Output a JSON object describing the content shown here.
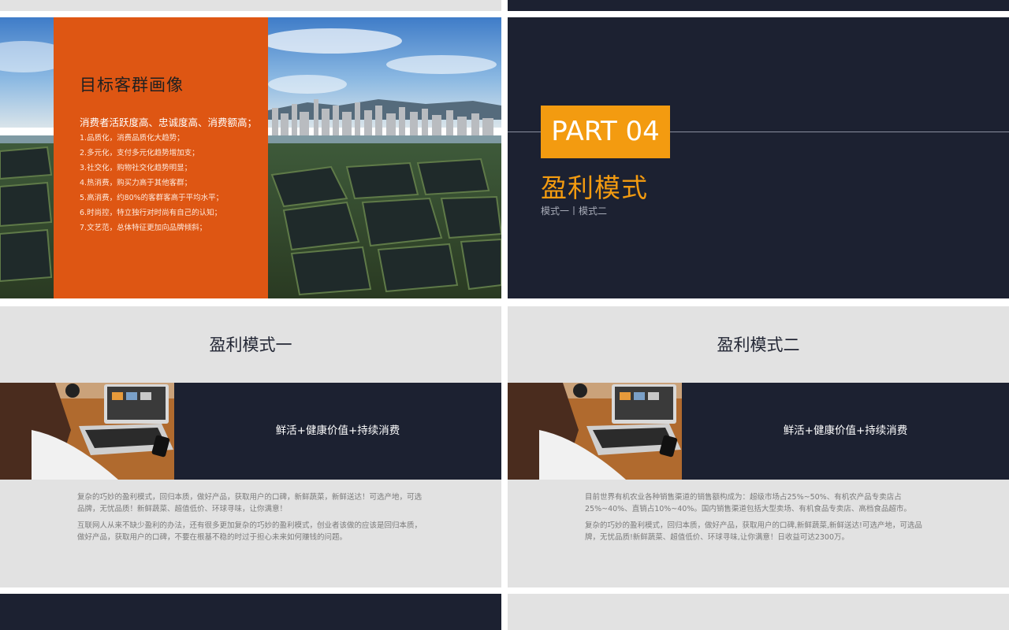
{
  "slide_target": {
    "title": "目标客群画像",
    "lead": "消费者活跃度高、忠诚度高、消费额高；",
    "items": [
      "1.品质化，消费品质化大趋势；",
      "2.多元化，支付多元化趋势增加支；",
      "3.社交化，购物社交化趋势明显；",
      "4.热消费，购买力高于其他客群；",
      "5.高消费，约80%的客群客高于平均水平；",
      "6.时尚控，特立独行对时尚有自己的认知；",
      "7.文艺范，总体特征更加向品牌倾斜；"
    ]
  },
  "slide_part": {
    "badge": "PART 04",
    "title": "盈利模式",
    "subtitle": "模式一丨模式二"
  },
  "slide_mode1": {
    "title": "盈利模式一",
    "band_text": "鲜活+健康价值+持续消费",
    "paragraphs": [
      "复杂的巧妙的盈利模式，回归本质，做好产品，获取用户的口碑，新鲜蔬菜，新鲜送达！可选产地，可选品牌，无忧品质！新鲜蔬菜、超值低价、环球寻味，让你满意！",
      "互联网人从来不缺少盈利的办法，还有很多更加复杂的巧妙的盈利模式，创业者该做的应该是回归本质，做好产品，获取用户的口碑，不要在根基不稳的时过于担心未来如何赚钱的问题。"
    ]
  },
  "slide_mode2": {
    "title": "盈利模式二",
    "band_text": "鲜活+健康价值+持续消费",
    "paragraphs": [
      "目前世界有机农业各种销售渠道的销售额构成为：超级市场占25%~50%、有机农产品专卖店占25%~40%、直销占10%~40%。国内销售渠道包括大型卖场、有机食品专卖店、高档食品超市。",
      "复杂的巧妙的盈利模式，回归本质，做好产品，获取用户的口碑,新鲜蔬菜,新鲜送达!可选产地，可选品牌，无忧品质!新鲜蔬菜、超值低价、环球寻味,让你满意！日收益可达2300万。"
    ]
  },
  "colors": {
    "orange": "#de5613",
    "navy": "#1c2131",
    "amber": "#f39b10",
    "light_gray": "#e2e2e2"
  }
}
